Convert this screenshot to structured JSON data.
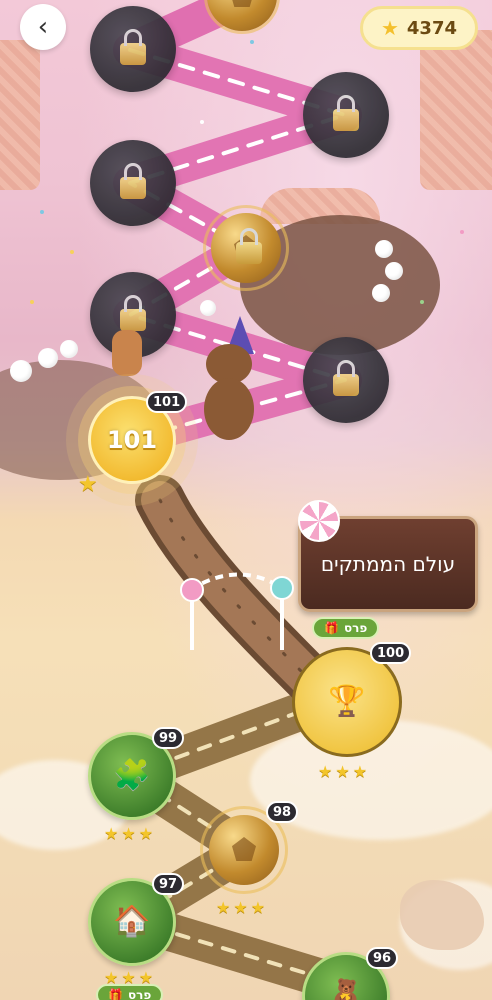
{
  "header": {
    "back_icon": "chevron-left-icon",
    "back_symbol": "‹",
    "coins": {
      "icon": "star-coin-icon",
      "symbol": "★",
      "value": "4374"
    }
  },
  "world_sign": {
    "title": "עולם הממתקים",
    "reward_label": "פרס",
    "reward_icon": "gift-icon"
  },
  "levels": {
    "locked_icon": "padlock-icon",
    "current": {
      "label": "101",
      "badge": "101",
      "stars": "★"
    },
    "level_100": {
      "badge": "100",
      "icon": "trophy-icon",
      "stars": "★★★"
    },
    "level_99": {
      "badge": "99",
      "icon": "puzzle-icon",
      "stars": "★★★"
    },
    "level_98": {
      "badge": "98",
      "icon": "crowned-ball-icon",
      "stars": "★★★"
    },
    "level_97": {
      "badge": "97",
      "icon": "house-icon",
      "stars": "★★★",
      "reward_label": "פרס"
    },
    "level_96": {
      "badge": "96",
      "icon": "teddy-bear-icon"
    }
  },
  "colors": {
    "path_pink": "#e06fb0",
    "path_brown": "#8a6a3c",
    "node_green": "#4f8f33",
    "node_locked": "#2f2c34",
    "gold": "#f2c43f"
  }
}
